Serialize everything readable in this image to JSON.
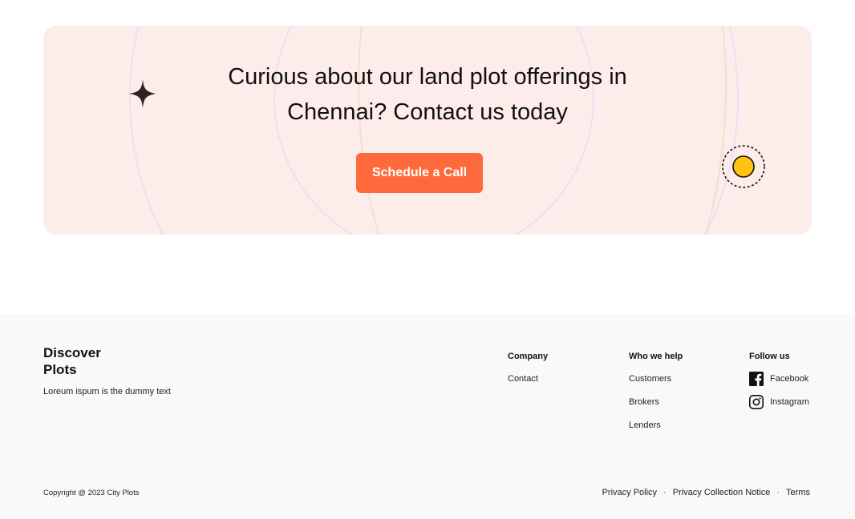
{
  "cta": {
    "heading_line1": "Curious about our land plot offerings in",
    "heading_line2": "Chennai? Contact us today",
    "button_label": "Schedule a Call",
    "background_color": "#fdedea",
    "button_color": "#ff6a3d",
    "icons": [
      "sparkle-icon",
      "sun-icon"
    ]
  },
  "footer": {
    "logo_line1": "Discover",
    "logo_line2": "Plots",
    "tagline": "Loreum ispum is the dummy text",
    "columns": {
      "company": {
        "title": "Company",
        "links": [
          "Contact"
        ]
      },
      "who_we_help": {
        "title": "Who we help",
        "links": [
          "Customers",
          "Brokers",
          "Lenders"
        ]
      },
      "follow_us": {
        "title": "Follow us",
        "links": [
          {
            "label": "Facebook",
            "icon": "facebook-icon"
          },
          {
            "label": "Instagram",
            "icon": "instagram-icon"
          }
        ]
      }
    },
    "copyright": "Copyright @ 2023 City Plots",
    "legal_links": [
      "Privacy Policy",
      "Privacy Collection Notice",
      "Terms"
    ],
    "separator": "·",
    "background_color": "#f9f9f9"
  }
}
